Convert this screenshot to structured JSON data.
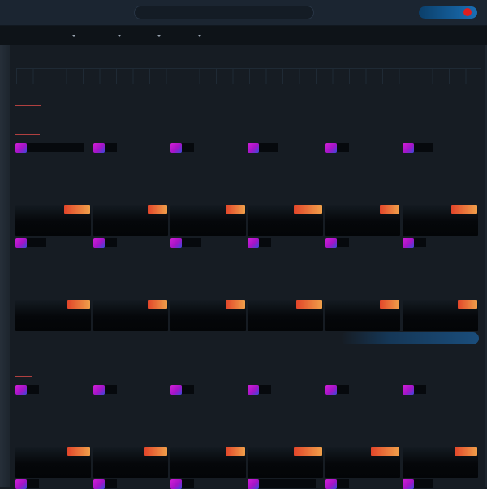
{
  "header": {
    "search": {
      "value": "",
      "placeholder": ""
    },
    "status": {
      "active": true,
      "indicator_color": "#e01e1e"
    }
  },
  "nav": {
    "menus": [
      {
        "label": "",
        "icon": "chevron-down-icon"
      },
      {
        "label": "",
        "icon": "chevron-down-icon"
      },
      {
        "label": "",
        "icon": "chevron-down-icon"
      },
      {
        "label": "",
        "icon": "chevron-down-icon"
      }
    ]
  },
  "sections": [
    {
      "title": "",
      "rows": [
        {
          "tiles": [
            {
              "title": "",
              "badge": ""
            },
            {
              "title": "",
              "badge": ""
            },
            {
              "title": "",
              "badge": ""
            },
            {
              "title": "",
              "badge": ""
            },
            {
              "title": "",
              "badge": ""
            },
            {
              "title": "",
              "badge": ""
            }
          ]
        },
        {
          "tiles": [
            {
              "title": "",
              "badge": ""
            },
            {
              "title": "",
              "badge": ""
            },
            {
              "title": "",
              "badge": ""
            },
            {
              "title": "",
              "badge": ""
            },
            {
              "title": "",
              "badge": ""
            },
            {
              "title": "",
              "badge": ""
            }
          ]
        }
      ]
    },
    {
      "title": "",
      "rows": [
        {
          "tiles": [
            {
              "title": "",
              "badge": ""
            },
            {
              "title": "",
              "badge": ""
            },
            {
              "title": "",
              "badge": ""
            },
            {
              "title": "",
              "badge": ""
            },
            {
              "title": "",
              "badge": ""
            },
            {
              "title": "",
              "badge": ""
            }
          ]
        },
        {
          "tiles": [
            {
              "title": "",
              "badge": ""
            },
            {
              "title": "",
              "badge": ""
            },
            {
              "title": "",
              "badge": ""
            },
            {
              "title": "",
              "badge": ""
            },
            {
              "title": "",
              "badge": ""
            },
            {
              "title": "",
              "badge": ""
            }
          ]
        }
      ]
    }
  ],
  "colors": {
    "background": "#161c23",
    "header": "#1b2531",
    "nav": "#0e1318",
    "accent_red": "#e01e1e",
    "accent_blue": "#1a6fb5",
    "badge_start": "#e2452a",
    "badge_end": "#f0a04a",
    "tile_icon": "#c21bd0"
  }
}
